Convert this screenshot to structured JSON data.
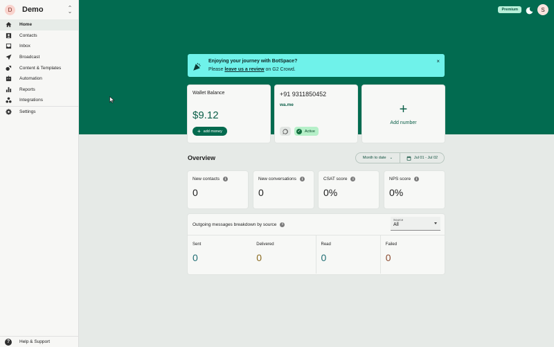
{
  "workspace": {
    "initial": "D",
    "name": "Demo"
  },
  "sidebar": {
    "items": [
      {
        "label": "Home",
        "icon": "home-icon"
      },
      {
        "label": "Contacts",
        "icon": "contacts-icon"
      },
      {
        "label": "Inbox",
        "icon": "inbox-icon"
      },
      {
        "label": "Broadcast",
        "icon": "broadcast-icon"
      },
      {
        "label": "Content & Templates",
        "icon": "templates-icon"
      },
      {
        "label": "Automation",
        "icon": "automation-icon"
      },
      {
        "label": "Reports",
        "icon": "reports-icon"
      },
      {
        "label": "Integrations",
        "icon": "integrations-icon"
      },
      {
        "label": "Settings",
        "icon": "settings-icon"
      }
    ],
    "help": "Help & Support"
  },
  "header": {
    "premium": "Premium",
    "user_initial": "S"
  },
  "banner": {
    "title": "Enjoying your journey with BotSpace?",
    "pre": "Please ",
    "link": "leave us a review",
    "post": " on G2 Crowd.",
    "close": "×"
  },
  "wallet": {
    "title": "Wallet Balance",
    "amount": "$9.12",
    "button": "add money"
  },
  "phone": {
    "number": "+91 9311850452",
    "link": "wa.me",
    "status": "Active"
  },
  "add_number": {
    "label": "Add number"
  },
  "overview": {
    "title": "Overview",
    "range_preset": "Month to date",
    "range_dates": "Jul 01 - Jul 02",
    "stats": [
      {
        "title": "New contacts",
        "value": "0"
      },
      {
        "title": "New conversations",
        "value": "0"
      },
      {
        "title": "CSAT score",
        "value": "0%"
      },
      {
        "title": "NPS score",
        "value": "0%"
      }
    ]
  },
  "breakdown": {
    "title": "Outgoing messages breakdown by source",
    "source_label": "Source",
    "source_value": "All",
    "columns": [
      {
        "label": "Sent",
        "value": "0",
        "color": "#1f6d73"
      },
      {
        "label": "Delivered",
        "value": "0",
        "color": "#8a6a1f"
      },
      {
        "label": "Read",
        "value": "0",
        "color": "#1f6d73"
      },
      {
        "label": "Failed",
        "value": "0",
        "color": "#8a4a2f"
      }
    ]
  },
  "colors": {
    "brand": "#026b50",
    "banner": "#6ff2ea",
    "background": "#e6eae7"
  }
}
